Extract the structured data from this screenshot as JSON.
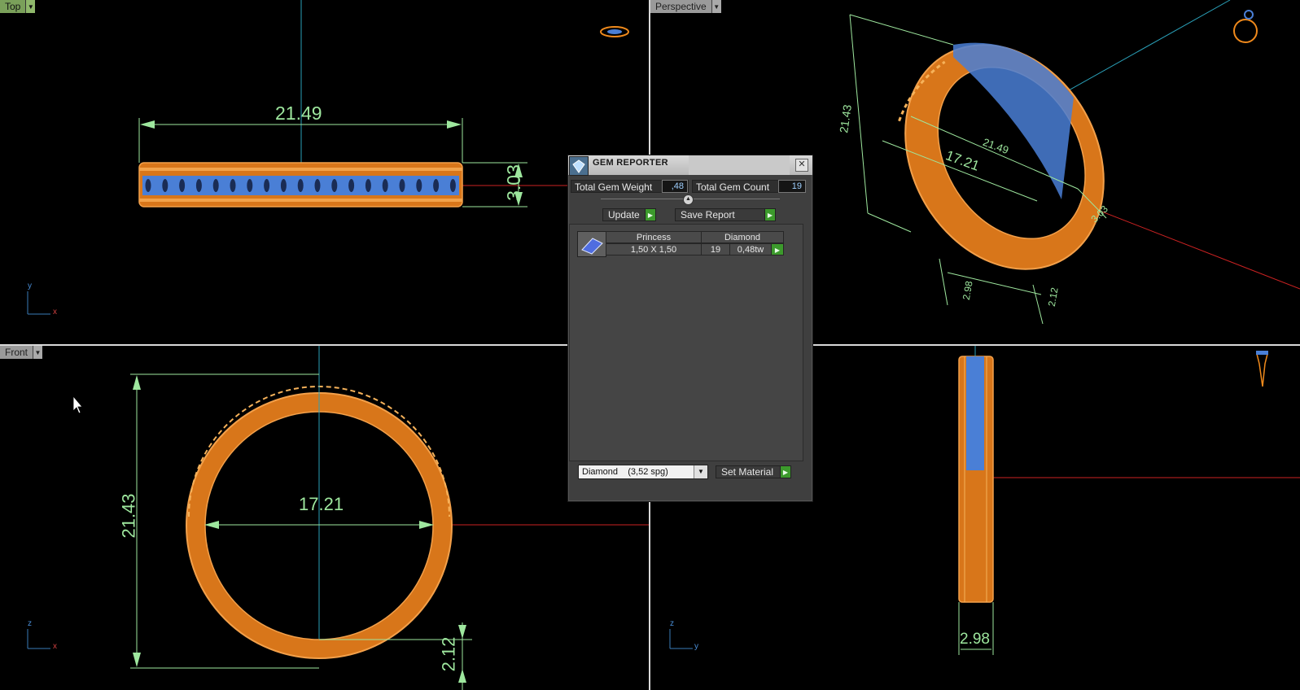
{
  "viewports": {
    "top": {
      "label": "Top",
      "dim_length": "21.49",
      "dim_height": "3.03",
      "axis_x": "x",
      "axis_y": "y"
    },
    "perspective": {
      "label": "Perspective",
      "dim_height": "21.43",
      "dim_inner": "17.21",
      "dim_length": "21.49",
      "dim_width": "3.03",
      "dim_a": "2.98",
      "dim_b": "2.12"
    },
    "front": {
      "label": "Front",
      "dim_height": "21.43",
      "dim_inner": "17.21",
      "dim_thickness": "2.12",
      "axis_x": "x",
      "axis_z": "z"
    },
    "right": {
      "dim_width": "2.98",
      "axis_y": "y",
      "axis_z": "z"
    }
  },
  "gem_reporter": {
    "title": "GEM REPORTER",
    "close": "✕",
    "total_weight_label": "Total Gem Weight",
    "total_weight_value": ",48",
    "total_count_label": "Total Gem Count",
    "total_count_value": "19",
    "update_label": "Update",
    "save_report_label": "Save Report",
    "gems": [
      {
        "cut": "Princess",
        "material": "Diamond",
        "size": "1,50 X 1,50",
        "count": "19",
        "weight": "0,48tw"
      }
    ],
    "material_select": "Diamond    (3,52 spg)",
    "set_material_label": "Set Material"
  },
  "colors": {
    "gold": "#f08a1c",
    "gem": "#4a7fd6",
    "dim": "#9ee79e",
    "axis_red": "#cc2222",
    "axis_cyan": "#2aa0b8"
  }
}
